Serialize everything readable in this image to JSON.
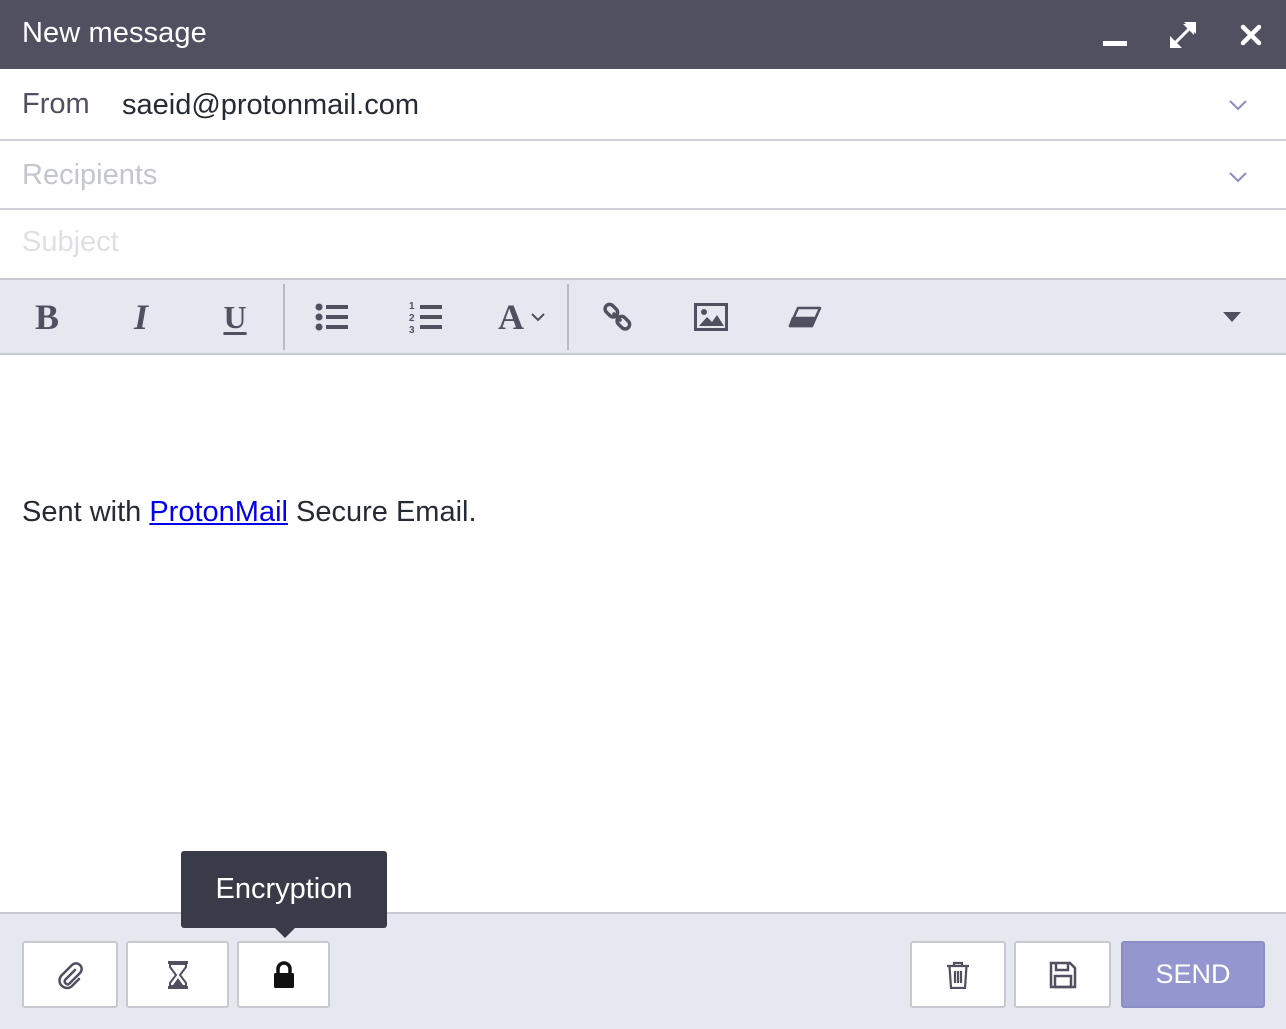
{
  "window": {
    "title": "New message",
    "icons": [
      "minimize-icon",
      "maximize-icon",
      "close-icon"
    ]
  },
  "header": {
    "from_label": "From",
    "from_value": "saeid@protonmail.com",
    "recipients_placeholder": "Recipients",
    "recipients_value": "",
    "subject_placeholder": "Subject",
    "subject_value": ""
  },
  "toolbar": {
    "items": [
      "bold",
      "italic",
      "underline",
      "bulleted-list",
      "numbered-list",
      "font-style",
      "link",
      "image",
      "clear-formatting",
      "more"
    ],
    "bold_glyph": "B",
    "italic_glyph": "I",
    "underline_glyph": "U",
    "font_glyph": "A"
  },
  "body": {
    "signature_prefix": "Sent with ",
    "signature_link": "ProtonMail",
    "signature_suffix": " Secure Email."
  },
  "footer": {
    "tooltip": "Encryption",
    "send_label": "SEND",
    "left_buttons": [
      "attachment",
      "expiration",
      "encryption"
    ],
    "right_buttons": [
      "delete",
      "save"
    ]
  },
  "colors": {
    "titlebar": "#505061",
    "toolbar_bg": "#e6e8ef",
    "send_button": "#9497cf",
    "tooltip_bg": "#3a3b49",
    "link": "#0000ee"
  }
}
